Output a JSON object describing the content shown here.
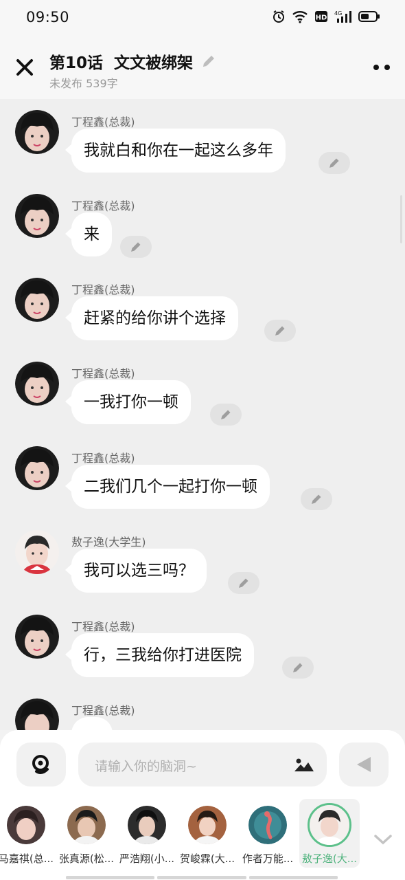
{
  "status": {
    "time": "09:50",
    "net": "4G"
  },
  "header": {
    "title": "第10话  文文被绑架",
    "subtitle": "未发布 539字"
  },
  "messages": [
    {
      "sender": "丁程鑫(总裁)",
      "text": "我就白和你在一起这么多年"
    },
    {
      "sender": "丁程鑫(总裁)",
      "text": "来"
    },
    {
      "sender": "丁程鑫(总裁)",
      "text": "赶紧的给你讲个选择"
    },
    {
      "sender": "丁程鑫(总裁)",
      "text": "一我打你一顿"
    },
    {
      "sender": "丁程鑫(总裁)",
      "text": "二我们几个一起打你一顿"
    },
    {
      "sender": "敖子逸(大学生)",
      "text": "我可以选三吗？"
    },
    {
      "sender": "丁程鑫(总裁)",
      "text": "行，三我给你打进医院"
    },
    {
      "sender": "丁程鑫(总裁)",
      "text": ""
    }
  ],
  "input": {
    "placeholder": "请输入你的脑洞~"
  },
  "characters": [
    {
      "label": "马嘉祺(总..."
    },
    {
      "label": "张真源(松..."
    },
    {
      "label": "严浩翔(小..."
    },
    {
      "label": "贺峻霖(大..."
    },
    {
      "label": "作者万能..."
    },
    {
      "label": "敖子逸(大...",
      "selected": true
    }
  ],
  "colors": {
    "accent": "#4fb37d",
    "bubble": "#ffffff",
    "background": "#efefef"
  }
}
